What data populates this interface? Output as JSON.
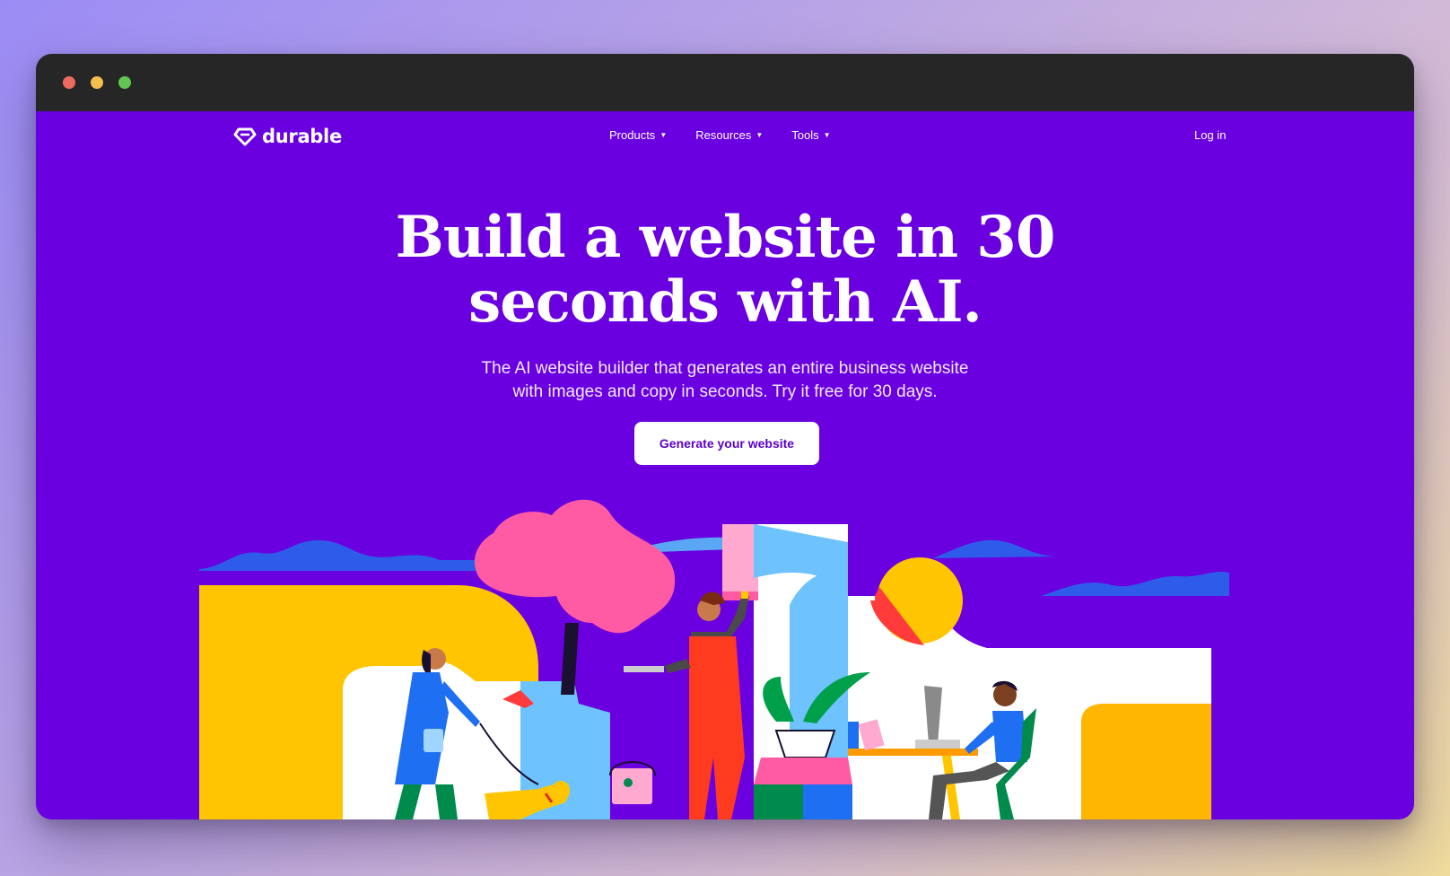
{
  "brand": {
    "name": "durable",
    "logo_icon": "diamond-logo-icon",
    "color": "#6a00e0"
  },
  "nav": {
    "items": [
      {
        "label": "Products",
        "icon": "caret-down-icon"
      },
      {
        "label": "Resources",
        "icon": "caret-down-icon"
      },
      {
        "label": "Tools",
        "icon": "caret-down-icon"
      }
    ],
    "login_label": "Log in"
  },
  "hero": {
    "title_line1": "Build a website in 30",
    "title_line2": "seconds with AI.",
    "subtitle_line1": "The AI website builder that generates an entire business website",
    "subtitle_line2": "with images and copy in seconds. Try it free for 30 days.",
    "cta_label": "Generate your website"
  },
  "colors": {
    "cta_text": "#5a00c8",
    "window_chrome": "#262626"
  }
}
